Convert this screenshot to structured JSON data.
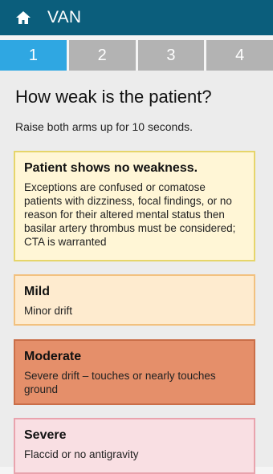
{
  "app_bar": {
    "title": "VAN",
    "home_icon": "home-icon"
  },
  "steps": [
    "1",
    "2",
    "3",
    "4"
  ],
  "active_step": "1",
  "question": "How weak is the patient?",
  "instruction": "Raise both arms up for 10 seconds.",
  "options": [
    {
      "name": "Patient shows no weakness.",
      "description": "Exceptions are confused or comatose patients with dizziness, focal findings, or no reason for their altered mental status then basilar artery thrombus must be considered; CTA is warranted"
    },
    {
      "name": "Mild",
      "description": "Minor drift"
    },
    {
      "name": "Moderate",
      "description": "Severe drift – touches or nearly touches ground"
    },
    {
      "name": "Severe",
      "description": "Flaccid or no antigravity"
    }
  ],
  "colors": {
    "app_bar": "#0b5e7c",
    "active_tab": "#2fa7e2",
    "inactive_tab": "#b3b3b3",
    "no_weakness": "#fff6d6",
    "mild": "#feebcf",
    "moderate": "#e58f6a",
    "severe": "#f9dfe3"
  }
}
